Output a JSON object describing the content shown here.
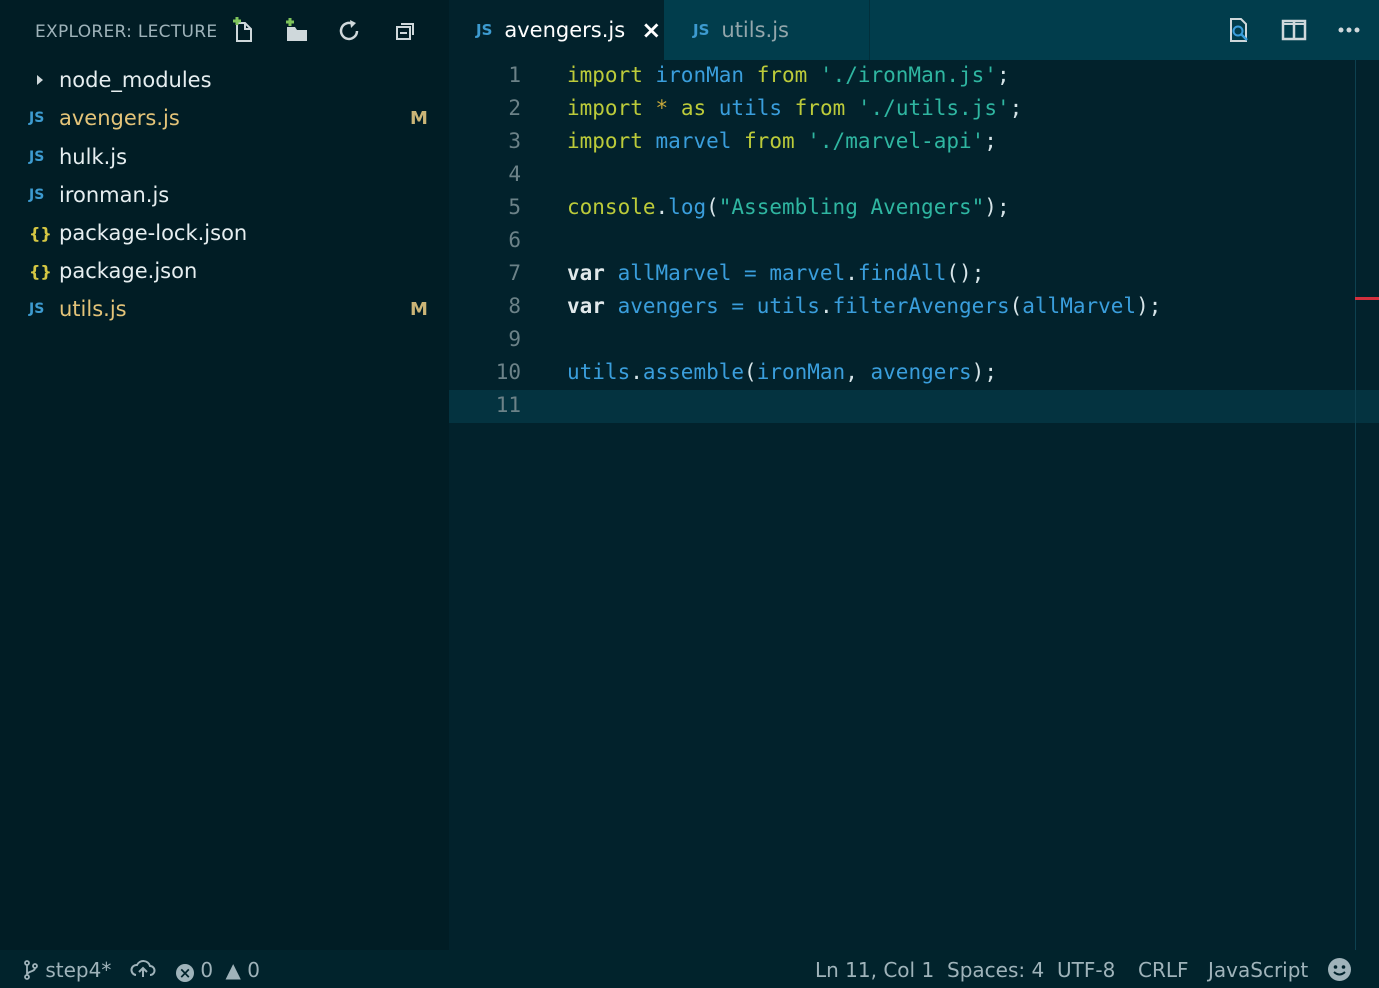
{
  "explorer": {
    "title": "EXPLORER: LECTURE",
    "items": [
      {
        "label": "node_modules",
        "type": "folder",
        "icon": "chevron-right-icon",
        "badge": ""
      },
      {
        "label": "avengers.js",
        "type": "js",
        "icon": "JS",
        "badge": "M"
      },
      {
        "label": "hulk.js",
        "type": "js",
        "icon": "JS",
        "badge": ""
      },
      {
        "label": "ironman.js",
        "type": "js",
        "icon": "JS",
        "badge": ""
      },
      {
        "label": "package-lock.json",
        "type": "json",
        "icon": "{}",
        "badge": ""
      },
      {
        "label": "package.json",
        "type": "json",
        "icon": "{}",
        "badge": ""
      },
      {
        "label": "utils.js",
        "type": "js",
        "icon": "JS",
        "badge": "M"
      }
    ],
    "actions": [
      "new-file-icon",
      "new-folder-icon",
      "refresh-icon",
      "collapse-all-icon"
    ]
  },
  "tabs": [
    {
      "label": "avengers.js",
      "icon": "JS",
      "active": true
    },
    {
      "label": "utils.js",
      "icon": "JS",
      "active": false
    }
  ],
  "editor": {
    "line_numbers": [
      "1",
      "2",
      "3",
      "4",
      "5",
      "6",
      "7",
      "8",
      "9",
      "10",
      "11"
    ],
    "lines": [
      "import ironMan from './ironMan.js';",
      "import * as utils from './utils.js';",
      "import marvel from './marvel-api';",
      "",
      "console.log(\"Assembling Avengers\");",
      "",
      "var allMarvel = marvel.findAll();",
      "var avengers = utils.filterAvengers(allMarvel);",
      "",
      "utils.assemble(ironMan, avengers);",
      ""
    ],
    "current_line": 11
  },
  "status": {
    "branch": "step4*",
    "errors": "0",
    "warnings": "0",
    "position": "Ln 11, Col 1",
    "spaces": "Spaces: 4",
    "encoding": "UTF-8",
    "eol": "CRLF",
    "language": "JavaScript"
  },
  "colors": {
    "sidebar_bg": "#011d25",
    "editor_bg": "#02222c",
    "tabbar_bg": "#013d4c",
    "keyword": "#bccb3a",
    "identifier": "#3a9edc",
    "string": "#2fb6a1",
    "modified": "#e4c479"
  }
}
